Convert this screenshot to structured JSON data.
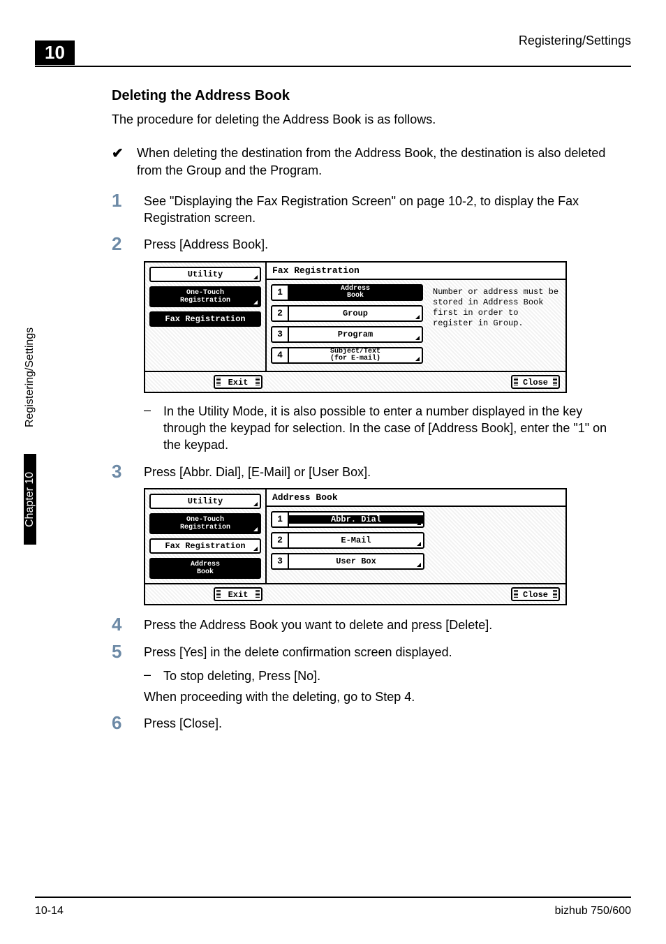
{
  "header": {
    "right": "Registering/Settings",
    "chapter_num": "10"
  },
  "sidetab": {
    "black": "Chapter 10",
    "label": "Registering/Settings"
  },
  "footer": {
    "left": "10-14",
    "right": "bizhub 750/600"
  },
  "section_title": "Deleting the Address Book",
  "intro": "The procedure for deleting the Address Book is as follows.",
  "check_mark": "✔",
  "check_text": "When deleting the destination from the Address Book, the destination is also deleted from the Group and the Program.",
  "steps": {
    "s1": {
      "num": "1",
      "text": "See \"Displaying the Fax Registration Screen\" on page 10-2, to display the Fax Registration screen."
    },
    "s2": {
      "num": "2",
      "text": "Press [Address Book]."
    },
    "s2_sub_dash": "–",
    "s2_sub": "In the Utility Mode, it is also possible to enter a number displayed in the key through the keypad for selection. In the case of [Address Book], enter the \"1\" on the keypad.",
    "s3": {
      "num": "3",
      "text": "Press [Abbr. Dial], [E-Mail] or [User Box]."
    },
    "s4": {
      "num": "4",
      "text": "Press the Address Book you want to delete and press [Delete]."
    },
    "s5": {
      "num": "5",
      "text": "Press [Yes] in the delete confirmation screen displayed."
    },
    "s5_sub_dash": "–",
    "s5_sub": "To stop deleting, Press [No].",
    "s5_note": "When proceeding with the deleting, go to Step 4.",
    "s6": {
      "num": "6",
      "text": "Press [Close]."
    }
  },
  "screen1": {
    "left_tabs": {
      "utility": "Utility",
      "onetouch": "One-Touch\nRegistration",
      "faxreg": "Fax Registration"
    },
    "title": "Fax Registration",
    "items": {
      "i1": {
        "n": "1",
        "label": "Address\nBook"
      },
      "i2": {
        "n": "2",
        "label": "Group"
      },
      "i3": {
        "n": "3",
        "label": "Program"
      },
      "i4": {
        "n": "4",
        "label": "Subject/Text\n(for E-mail)"
      }
    },
    "msg": "Number or address must be stored in Address Book first in order to register in Group.",
    "exit": "Exit",
    "close": "Close"
  },
  "screen2": {
    "left_tabs": {
      "utility": "Utility",
      "onetouch": "One-Touch\nRegistration",
      "faxreg": "Fax Registration",
      "addrbook": "Address\nBook"
    },
    "title": "Address Book",
    "items": {
      "i1": {
        "n": "1",
        "label": "Abbr. Dial"
      },
      "i2": {
        "n": "2",
        "label": "E-Mail"
      },
      "i3": {
        "n": "3",
        "label": "User Box"
      }
    },
    "exit": "Exit",
    "close": "Close"
  }
}
